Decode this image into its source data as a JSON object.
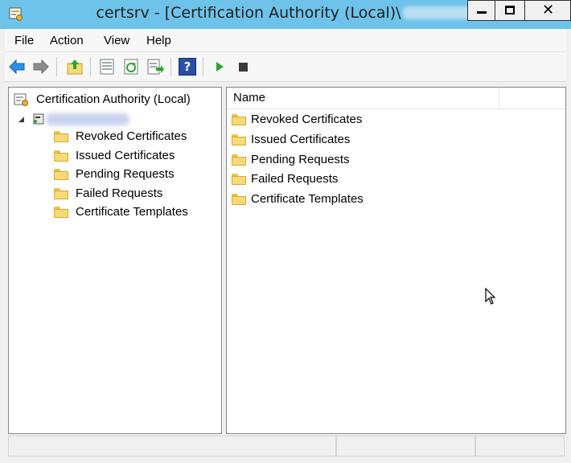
{
  "window": {
    "title": "certsrv - [Certification Authority (Local)\\",
    "controls": {
      "minimize_icon": "minimize-icon",
      "maximize_icon": "maximize-icon",
      "close_icon": "close-icon",
      "close_glyph": "✕"
    }
  },
  "menu": [
    "File",
    "Action",
    "View",
    "Help"
  ],
  "toolbar": {
    "buttons": [
      "back-arrow-icon",
      "forward-arrow-icon",
      "up-folder-icon",
      "show-hide-console-tree-icon",
      "refresh-icon",
      "export-list-icon",
      "help-icon",
      "start-service-icon",
      "stop-service-icon"
    ],
    "help_glyph": "?"
  },
  "tree": {
    "root_label": "Certification Authority (Local)",
    "expand_glyph": "◢",
    "children": [
      "Revoked Certificates",
      "Issued Certificates",
      "Pending Requests",
      "Failed Requests",
      "Certificate Templates"
    ]
  },
  "list": {
    "column_name": "Name",
    "items": [
      "Revoked Certificates",
      "Issued Certificates",
      "Pending Requests",
      "Failed Requests",
      "Certificate Templates"
    ]
  },
  "colors": {
    "title_bar": "#6ec3ea",
    "folder": "#f7d977",
    "nav_arrow": "#2f8ee6",
    "play": "#2aa82a"
  }
}
